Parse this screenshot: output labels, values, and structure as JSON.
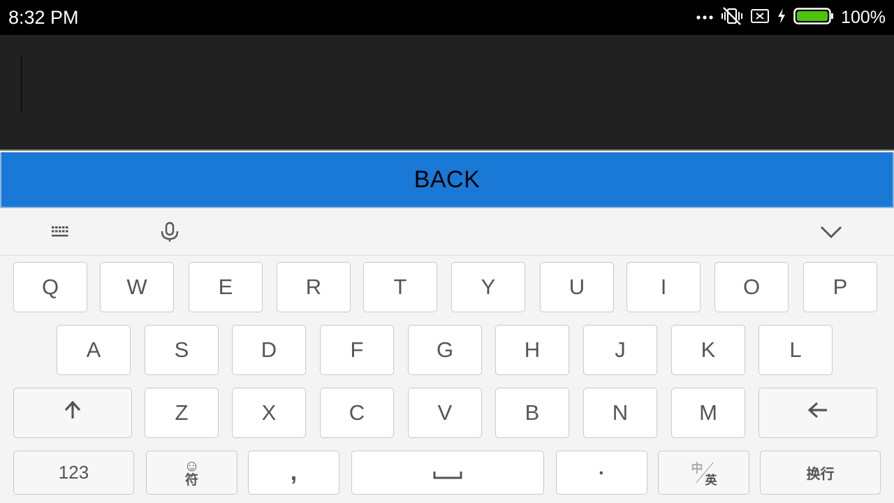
{
  "status_bar": {
    "time": "8:32 PM",
    "battery_percent": "100%",
    "battery_level": 1.0,
    "icons": [
      "more-dots-icon",
      "vibrate-off-icon",
      "no-sim-icon",
      "charging-bolt-icon",
      "battery-icon"
    ]
  },
  "text_input": {
    "value": ""
  },
  "back_button": {
    "label": "BACK"
  },
  "toolbar": {
    "icons": [
      "keyboard-grid-icon",
      "microphone-icon",
      "collapse-chevron-icon"
    ]
  },
  "keyboard": {
    "row1": [
      "Q",
      "W",
      "E",
      "R",
      "T",
      "Y",
      "U",
      "I",
      "O",
      "P"
    ],
    "row2": [
      "A",
      "S",
      "D",
      "F",
      "G",
      "H",
      "J",
      "K",
      "L"
    ],
    "row3": [
      "Z",
      "X",
      "C",
      "V",
      "B",
      "N",
      "M"
    ],
    "numbers_label": "123",
    "symbols_label": "符",
    "comma_label": ",",
    "period_label": "·",
    "lang_zh": "中",
    "lang_en": "英",
    "enter_label": "换行"
  },
  "colors": {
    "status_bar": "#000000",
    "text_area": "#212121",
    "back_button": "#1a78d6",
    "keyboard_bg": "#f4f4f4",
    "key_bg": "#ffffff",
    "battery_fill": "#4cc30e"
  }
}
